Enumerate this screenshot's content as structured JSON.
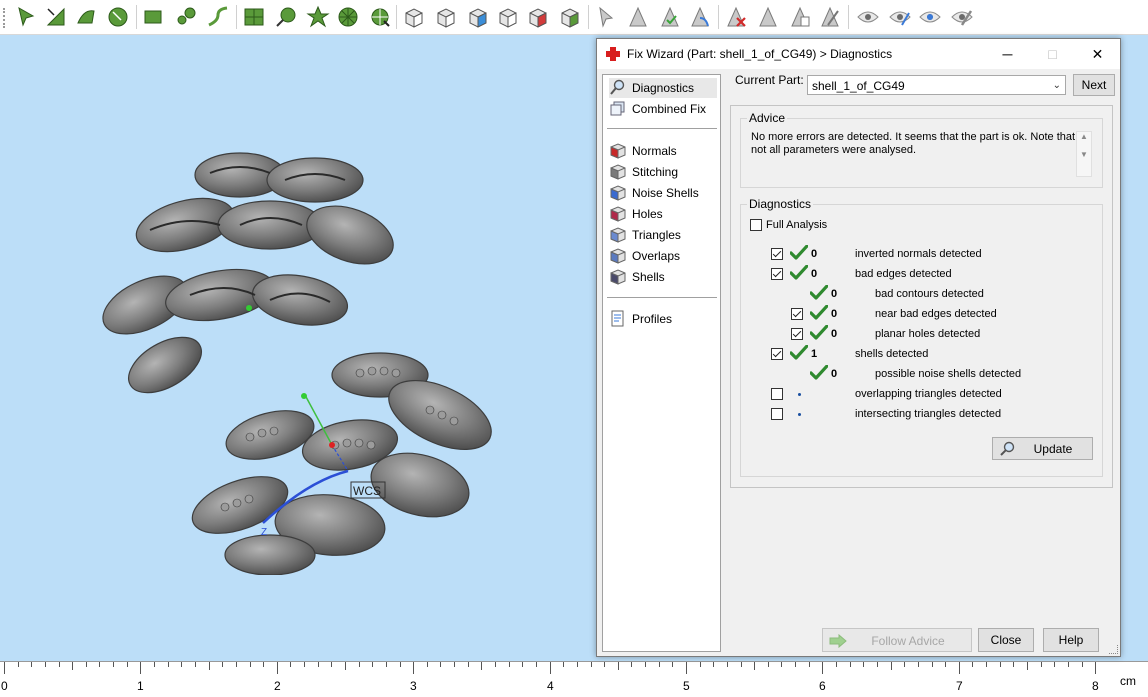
{
  "toolbar": {
    "icons": [
      "select-arrow-icon",
      "select-triangle-icon",
      "select-surface-icon",
      "select-shell-icon",
      "rectangle-select-icon",
      "lasso-select-icon",
      "curve-select-icon",
      "grid-select-icon",
      "brush-select-icon",
      "flower-select-icon",
      "circle-select-icon",
      "wheel-select-icon",
      "view-cube-front-icon",
      "view-cube-top-icon",
      "view-cube-side-icon",
      "view-cube-iso-icon",
      "view-cube-red-icon",
      "view-cube-green-icon",
      "arrow-cursor-icon",
      "triangle-grey-icon",
      "triangle-check-icon",
      "triangle-green-icon",
      "delete-triangle-icon",
      "triangle-grey-2-icon",
      "triangle-copy-icon",
      "triangle-eraser-icon",
      "eye-icon",
      "eye-pen-icon",
      "eye-blue-icon",
      "eye-pencil-icon"
    ]
  },
  "ruler": {
    "labels": [
      "0",
      "1",
      "2",
      "3",
      "4",
      "5",
      "6",
      "7",
      "8"
    ],
    "unit": "cm"
  },
  "viewport": {
    "wcs_label": "WCS",
    "z_label": "Z"
  },
  "dialog": {
    "title": "Fix Wizard (Part: shell_1_of_CG49) > Diagnostics",
    "current_part_label": "Current Part:",
    "current_part_value": "shell_1_of_CG49",
    "next_label": "Next",
    "nav": [
      {
        "label": "Diagnostics",
        "icon": "magnifier-icon"
      },
      {
        "label": "Combined Fix",
        "icon": "combined-fix-icon"
      },
      {
        "label": "Normals",
        "icon": "normals-cube-icon"
      },
      {
        "label": "Stitching",
        "icon": "stitching-cube-icon"
      },
      {
        "label": "Noise Shells",
        "icon": "noise-shells-icon"
      },
      {
        "label": "Holes",
        "icon": "holes-cube-icon"
      },
      {
        "label": "Triangles",
        "icon": "triangles-cube-icon"
      },
      {
        "label": "Overlaps",
        "icon": "overlaps-cube-icon"
      },
      {
        "label": "Shells",
        "icon": "shells-cube-icon"
      },
      {
        "label": "Profiles",
        "icon": "profiles-page-icon"
      }
    ],
    "advice_title": "Advice",
    "advice_text": "No more errors are detected. It seems that the part is ok. Note that not all parameters were analysed.",
    "diagnostics_title": "Diagnostics",
    "full_analysis_label": "Full Analysis",
    "rows": [
      {
        "checked": true,
        "has_box": true,
        "indent": 0,
        "status": "ok",
        "count": "0",
        "text": "inverted normals detected"
      },
      {
        "checked": true,
        "has_box": true,
        "indent": 0,
        "status": "ok",
        "count": "0",
        "text": "bad edges detected"
      },
      {
        "checked": false,
        "has_box": false,
        "indent": 1,
        "status": "ok",
        "count": "0",
        "text": "bad contours detected"
      },
      {
        "checked": true,
        "has_box": true,
        "indent": 1,
        "status": "ok",
        "count": "0",
        "text": "near bad edges detected"
      },
      {
        "checked": true,
        "has_box": true,
        "indent": 1,
        "status": "ok",
        "count": "0",
        "text": "planar holes detected"
      },
      {
        "checked": true,
        "has_box": true,
        "indent": 0,
        "status": "ok",
        "count": "1",
        "text": "shells detected"
      },
      {
        "checked": false,
        "has_box": false,
        "indent": 1,
        "status": "ok",
        "count": "0",
        "text": "possible noise shells detected"
      },
      {
        "checked": false,
        "has_box": true,
        "indent": 0,
        "status": "dot",
        "count": "",
        "text": "overlapping triangles detected"
      },
      {
        "checked": false,
        "has_box": true,
        "indent": 0,
        "status": "dot",
        "count": "",
        "text": "intersecting triangles detected"
      }
    ],
    "update_label": "Update",
    "follow_advice_label": "Follow Advice",
    "close_label": "Close",
    "help_label": "Help"
  },
  "colors": {
    "viewport_bg": "#bcdef8",
    "check_green": "#2f8a2f",
    "toolbar_green": "#5a9a3a"
  }
}
